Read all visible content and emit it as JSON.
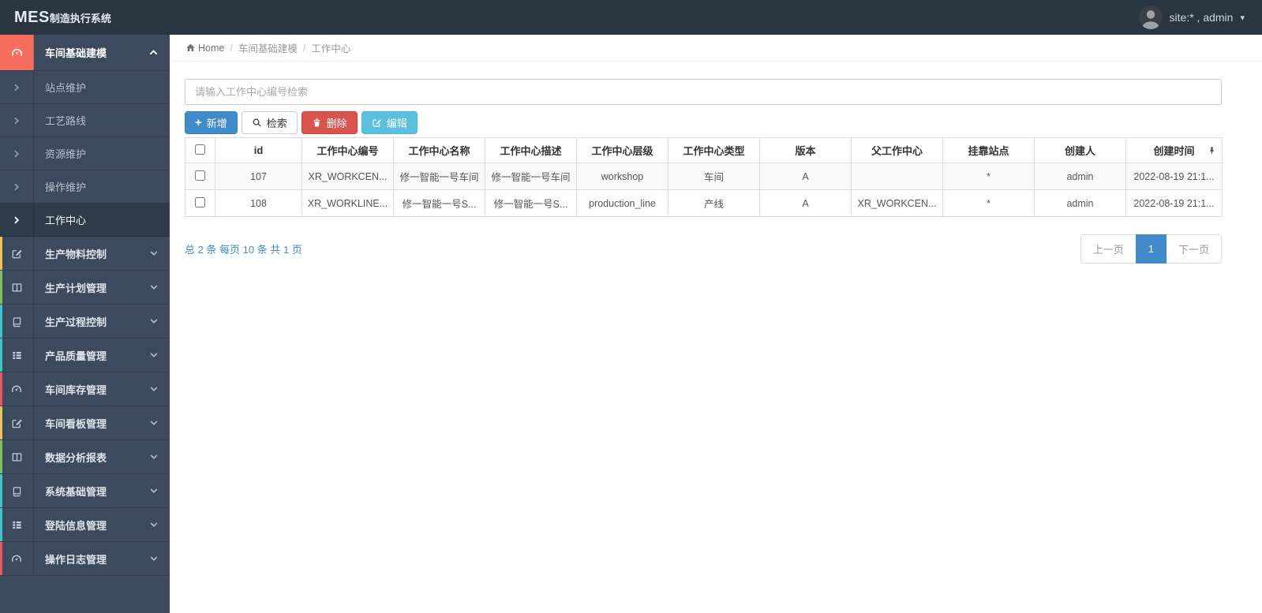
{
  "colors": {
    "primary": "#428bca",
    "danger": "#d9534f",
    "info": "#5bc0de",
    "root_icon_bg": "#f76e5f"
  },
  "topbar": {
    "logo_main": "MES",
    "logo_suffix": "制造执行系统",
    "user_label": "site:* , admin"
  },
  "breadcrumb": {
    "home": "Home",
    "sep1": "/",
    "level1": "车间基础建模",
    "sep2": "/",
    "level2": "工作中心"
  },
  "sidebar": {
    "root_label": "车间基础建模",
    "children": [
      "站点维护",
      "工艺路线",
      "资源维护",
      "操作维护",
      "工作中心"
    ],
    "sections": [
      {
        "label": "生产物料控制",
        "strip": "#edc25e"
      },
      {
        "label": "生产计划管理",
        "strip": "#84c05e"
      },
      {
        "label": "生产过程控制",
        "strip": "#3fc6c9"
      },
      {
        "label": "产品质量管理",
        "strip": "#3fc6c9"
      },
      {
        "label": "车间库存管理",
        "strip": "#ec5564"
      },
      {
        "label": "车间看板管理",
        "strip": "#edc25e"
      },
      {
        "label": "数据分析报表",
        "strip": "#84c05e"
      },
      {
        "label": "系统基础管理",
        "strip": "#3fc6c9"
      },
      {
        "label": "登陆信息管理",
        "strip": "#3fc6c9"
      },
      {
        "label": "操作日志管理",
        "strip": "#ec5564"
      }
    ]
  },
  "search": {
    "placeholder": "请输入工作中心编号检索"
  },
  "toolbar": {
    "add": "新增",
    "search": "检索",
    "delete": "删除",
    "edit": "编辑"
  },
  "table": {
    "headers": [
      "id",
      "工作中心编号",
      "工作中心名称",
      "工作中心描述",
      "工作中心层级",
      "工作中心类型",
      "版本",
      "父工作中心",
      "挂靠站点",
      "创建人",
      "创建时间"
    ],
    "rows": [
      {
        "cells": [
          "107",
          "XR_WORKCEN...",
          "修一智能一号车间",
          "修一智能一号车间",
          "workshop",
          "车间",
          "A",
          "",
          "*",
          "admin",
          "2022-08-19 21:1..."
        ]
      },
      {
        "cells": [
          "108",
          "XR_WORKLINE...",
          "修一智能一号S...",
          "修一智能一号S...",
          "production_line",
          "产线",
          "A",
          "XR_WORKCEN...",
          "*",
          "admin",
          "2022-08-19 21:1..."
        ]
      }
    ]
  },
  "pagination": {
    "summary": "总 2 条 每页 10 条 共 1 页",
    "prev": "上一页",
    "current": "1",
    "next": "下一页"
  }
}
